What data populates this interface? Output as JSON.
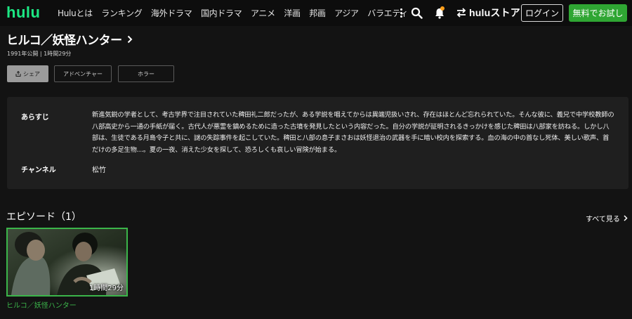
{
  "header": {
    "logo": "hulu",
    "nav": [
      "Huluとは",
      "ランキング",
      "海外ドラマ",
      "国内ドラマ",
      "アニメ",
      "洋画",
      "邦画",
      "アジア",
      "バラエティ"
    ],
    "store_label": "huluストア",
    "login_label": "ログイン",
    "trial_label": "無料でお試し"
  },
  "title": {
    "text": "ヒルコ／妖怪ハンター",
    "meta": "1991年公開 | 1時間29分"
  },
  "chips": {
    "share": "シェア",
    "adventure": "アドベンチャー",
    "horror": "ホラー"
  },
  "info": {
    "synopsis_label": "あらすじ",
    "synopsis": "新進気鋭の学者として、考古学界で注目されていた稗田礼二郎だったが、ある学説を唱えてからは異端児扱いされ、存在はほとんど忘れられていた。そんな彼に、義兄で中学校教師の八部高史から一通の手紙が届く。古代人が悪霊を鎮めるために造った古墳を発見したという内容だった。自分の学説が証明されるきっかけを感じた稗田は八部家を訪ねる。しかし八部は、生徒である月島令子と共に、謎の失踪事件を起こしていた。稗田と八部の息子まさおは妖怪退治の武器を手に暗い校内を探索する。血の海の中の首なし死体、美しい歌声、首だけの多足生物…。夏の一夜、消えた少女を探して、恐ろしくも哀しい冒険が始まる。",
    "channel_label": "チャンネル",
    "channel_value": "松竹"
  },
  "episodes": {
    "heading": "エピソード（1）",
    "see_all": "すべて見る",
    "items": [
      {
        "duration": "1時間29分",
        "title": "ヒルコ／妖怪ハンター"
      }
    ]
  },
  "colors": {
    "brand_green": "#1ce783",
    "accent_green": "#3bb54a",
    "trial_green": "#2fa633",
    "notification": "#ff9f1a"
  },
  "icons": [
    "more-icon",
    "search-icon",
    "bell-icon",
    "store-icon",
    "chevron-right-icon",
    "share-icon"
  ]
}
